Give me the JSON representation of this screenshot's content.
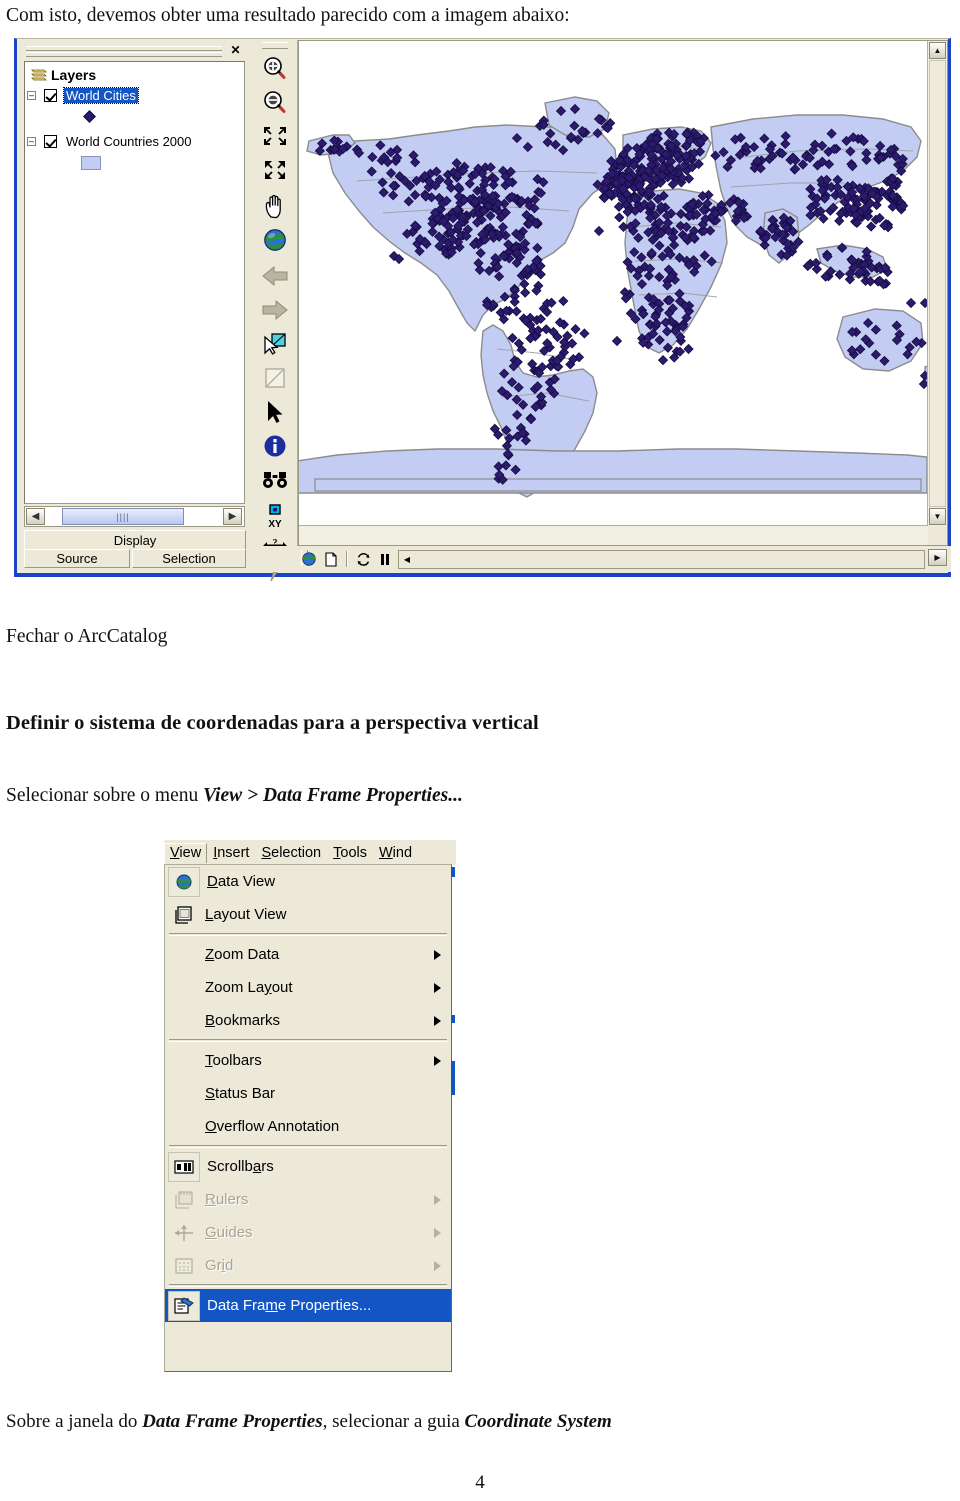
{
  "document": {
    "intro_text": "Com isto, devemos obter uma resultado parecido com a imagem abaixo:",
    "fechar_text": "Fechar o ArcCatalog",
    "heading_text": "Definir o sistema de coordenadas para a perspectiva vertical",
    "selecionar_prefix": "Selecionar sobre o menu ",
    "selecionar_emphasis": "View > Data Frame Properties...",
    "sobre_prefix": "Sobre a janela do ",
    "sobre_em1": "Data Frame Properties",
    "sobre_mid": ", selecionar a guia ",
    "sobre_em2": "Coordinate System",
    "page_number": "4"
  },
  "arcmap": {
    "toc": {
      "close_label": "✕",
      "root_label": "Layers",
      "layers": [
        {
          "name": "World Cities",
          "checked": true,
          "selected": true,
          "symbol": "point"
        },
        {
          "name": "World Countries 2000",
          "checked": true,
          "selected": false,
          "symbol": "polygon"
        }
      ],
      "scroll_left_glyph": "◀",
      "scroll_right_glyph": "▶",
      "thumb_grip": "||||",
      "tabs": {
        "display": "Display",
        "source": "Source",
        "selection": "Selection"
      }
    },
    "tools": [
      {
        "name": "zoom-in-tool",
        "title": "Zoom In"
      },
      {
        "name": "zoom-out-tool",
        "title": "Zoom Out"
      },
      {
        "name": "fixed-zoom-in-tool",
        "title": "Fixed Zoom In"
      },
      {
        "name": "fixed-zoom-out-tool",
        "title": "Fixed Zoom Out"
      },
      {
        "name": "pan-tool",
        "title": "Pan"
      },
      {
        "name": "full-extent-tool",
        "title": "Full Extent"
      },
      {
        "name": "go-back-extent-tool",
        "title": "Go Back To Previous Extent"
      },
      {
        "name": "go-next-extent-tool",
        "title": "Go To Next Extent"
      },
      {
        "name": "select-features-tool",
        "title": "Select Features"
      },
      {
        "name": "clear-selection-tool",
        "title": "Clear Selected Features"
      },
      {
        "name": "select-elements-tool",
        "title": "Select Elements"
      },
      {
        "name": "identify-tool",
        "title": "Identify"
      },
      {
        "name": "find-tool",
        "title": "Find"
      },
      {
        "name": "go-to-xy-tool",
        "title": "Go To XY"
      },
      {
        "name": "measure-tool",
        "title": "Measure"
      },
      {
        "name": "hyperlink-tool",
        "title": "Hyperlink"
      }
    ],
    "map_scroll": {
      "up_glyph": "▲",
      "down_glyph": "▼",
      "right_glyph": "▶"
    },
    "bottom_toolbar": {
      "items": [
        {
          "name": "globe-button",
          "glyph": "globe"
        },
        {
          "name": "page-button",
          "glyph": "page"
        },
        {
          "name": "refresh-button",
          "glyph": "refresh"
        },
        {
          "name": "pause-button",
          "glyph": "pause"
        }
      ],
      "combo_arrow": "◀",
      "right_arrow": "▶"
    }
  },
  "view_menu": {
    "menubar": [
      {
        "label": "View",
        "mnemonic": "V",
        "active": true
      },
      {
        "label": "Insert",
        "mnemonic": "I",
        "active": false
      },
      {
        "label": "Selection",
        "mnemonic": "S",
        "active": false
      },
      {
        "label": "Tools",
        "mnemonic": "T",
        "active": false
      },
      {
        "label": "Wind",
        "mnemonic": "W",
        "active": false
      }
    ],
    "items": [
      {
        "label": "Data View",
        "mnemonic": "D",
        "icon": "globe-icon",
        "framed": true,
        "submenu": false,
        "disabled": false,
        "highlight": false
      },
      {
        "label": "Layout View",
        "mnemonic": "L",
        "icon": "layout-page-icon",
        "framed": false,
        "submenu": false,
        "disabled": false,
        "highlight": false
      },
      {
        "separator": true
      },
      {
        "label": "Zoom Data",
        "mnemonic": "Z",
        "icon": null,
        "framed": false,
        "submenu": true,
        "disabled": false,
        "highlight": false
      },
      {
        "label": "Zoom Layout",
        "mnemonic": "y",
        "icon": null,
        "framed": false,
        "submenu": true,
        "disabled": false,
        "highlight": false
      },
      {
        "label": "Bookmarks",
        "mnemonic": "B",
        "icon": null,
        "framed": false,
        "submenu": true,
        "disabled": false,
        "highlight": false
      },
      {
        "separator": true
      },
      {
        "label": "Toolbars",
        "mnemonic": "T",
        "icon": null,
        "framed": false,
        "submenu": true,
        "disabled": false,
        "highlight": false
      },
      {
        "label": "Status Bar",
        "mnemonic": "S",
        "icon": null,
        "framed": false,
        "submenu": false,
        "disabled": false,
        "highlight": false
      },
      {
        "label": "Overflow Annotation",
        "mnemonic": "O",
        "icon": null,
        "framed": false,
        "submenu": false,
        "disabled": false,
        "highlight": false
      },
      {
        "separator": true
      },
      {
        "label": "Scrollbars",
        "mnemonic": "a",
        "icon": "scrollbars-icon",
        "framed": true,
        "submenu": false,
        "disabled": false,
        "highlight": false
      },
      {
        "label": "Rulers",
        "mnemonic": "R",
        "icon": "rulers-icon",
        "framed": false,
        "submenu": true,
        "disabled": true,
        "highlight": false
      },
      {
        "label": "Guides",
        "mnemonic": "G",
        "icon": "guides-icon",
        "framed": false,
        "submenu": true,
        "disabled": true,
        "highlight": false
      },
      {
        "label": "Grid",
        "mnemonic": "i",
        "icon": "grid-icon",
        "framed": false,
        "submenu": true,
        "disabled": true,
        "highlight": false
      },
      {
        "separator": true
      },
      {
        "label": "Data Frame Properties...",
        "mnemonic": "m",
        "icon": "properties-icon",
        "framed": true,
        "submenu": false,
        "disabled": false,
        "highlight": true
      }
    ]
  },
  "colors": {
    "window_border": "#1a44c8",
    "chrome": "#ece9d8",
    "selection_blue": "#1455c4",
    "land_fill": "#c3ccf2",
    "city_point": "#2b1a6e",
    "coastline": "#8c8c8c"
  }
}
